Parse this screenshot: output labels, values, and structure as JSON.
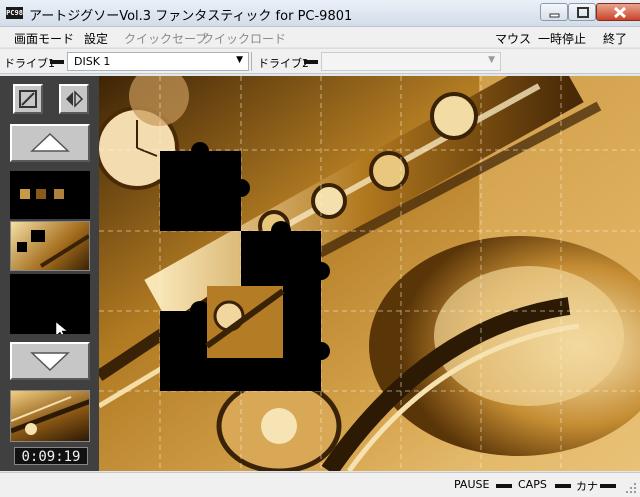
{
  "window": {
    "title": "アートジグソーVol.3 ファンタスティック for PC-9801",
    "icon": "PC98"
  },
  "menu": {
    "display_mode": "画面モード",
    "settings": "設定",
    "quick_save": "クイックセーブ",
    "quick_load": "クイックロード",
    "mouse": "マウス",
    "pause": "一時停止",
    "exit": "終了"
  },
  "drives": {
    "drive1_label": "ドライブ1",
    "drive1_value": "DISK 1",
    "drive2_label": "ドライブ2",
    "drive2_value": ""
  },
  "side_panel": {
    "timer": "0:09:19"
  },
  "status": {
    "pause": "PAUSE",
    "caps": "CAPS",
    "kana": "カナ"
  },
  "colors": {
    "sepia_dark": "#4a2c05",
    "sepia_mid": "#b98324",
    "sepia_light": "#f3d79a",
    "panel": "#404040"
  }
}
